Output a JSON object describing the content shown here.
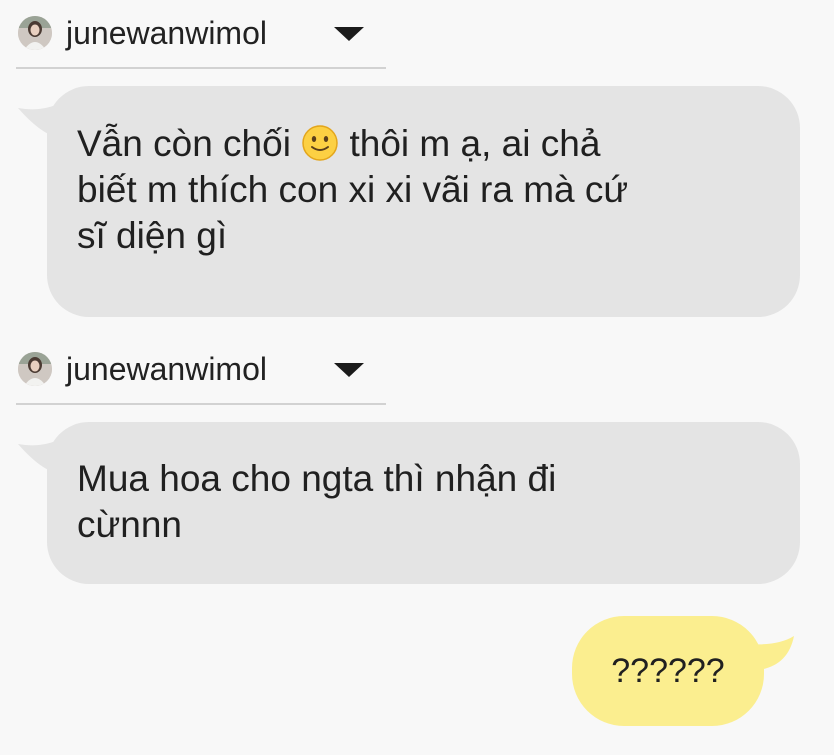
{
  "messages": [
    {
      "sender": "junewanwimol",
      "text_before_emoji": "Vẫn còn chối ",
      "emoji": "🙂",
      "text_after_emoji": " thôi m ạ, ai chả\nbiết m thích con xi xi vãi ra mà cứ\nsĩ diện gì"
    },
    {
      "sender": "junewanwimol",
      "text": "Mua hoa cho ngta thì nhận đi\ncừnnn"
    },
    {
      "sender": "me",
      "text": "??????"
    }
  ],
  "colors": {
    "background": "#f8f8f8",
    "incoming_bubble": "#e4e4e4",
    "outgoing_bubble": "#fbee8f",
    "divider": "#d2d2d2"
  },
  "icons": {
    "avatar": "profile-photo",
    "dropdown": "caret-down-icon",
    "emoji": "slightly-smiling-face"
  }
}
